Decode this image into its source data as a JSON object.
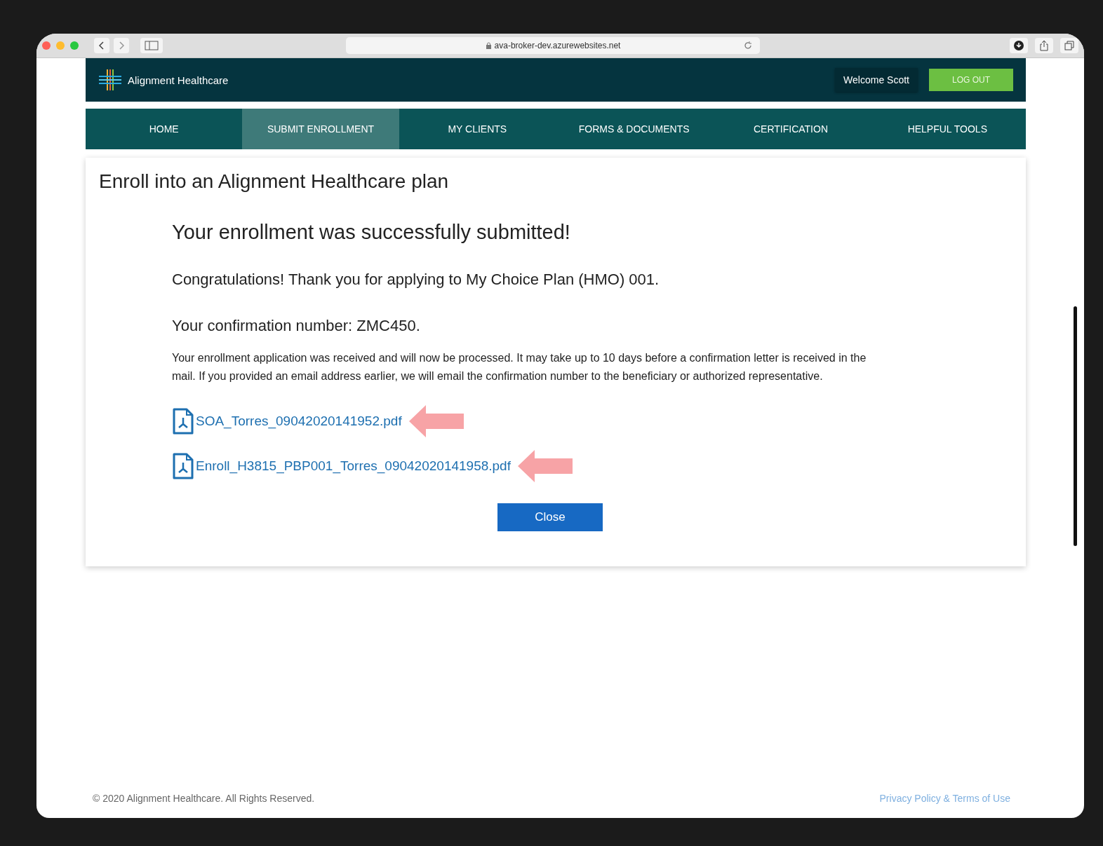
{
  "browser": {
    "url": "ava-broker-dev.azurewebsites.net"
  },
  "header": {
    "brand": "Alignment Healthcare",
    "welcome": "Welcome Scott",
    "logout": "LOG OUT"
  },
  "nav": [
    {
      "label": "HOME",
      "selected": false
    },
    {
      "label": "SUBMIT ENROLLMENT",
      "selected": true
    },
    {
      "label": "MY CLIENTS",
      "selected": false
    },
    {
      "label": "FORMS & DOCUMENTS",
      "selected": false
    },
    {
      "label": "CERTIFICATION",
      "selected": false
    },
    {
      "label": "HELPFUL TOOLS",
      "selected": false
    }
  ],
  "card": {
    "title": "Enroll into an Alignment Healthcare plan",
    "heading": "Your enrollment was successfully submitted!",
    "thanks": "Congratulations! Thank you for applying to My Choice Plan (HMO) 001.",
    "confirmation": "Your confirmation number: ZMC450.",
    "body": "Your enrollment application was received and will now be processed. It may take up to 10 days before a confirmation letter is received in the mail. If you provided an email address earlier, we will email the confirmation number to the beneficiary or authorized representative.",
    "files": [
      {
        "name": "SOA_Torres_09042020141952.pdf"
      },
      {
        "name": "Enroll_H3815_PBP001_Torres_09042020141958.pdf"
      }
    ],
    "close": "Close"
  },
  "footer": {
    "copyright": "© 2020 Alignment Healthcare. All Rights Reserved.",
    "link": "Privacy Policy & Terms of Use"
  }
}
